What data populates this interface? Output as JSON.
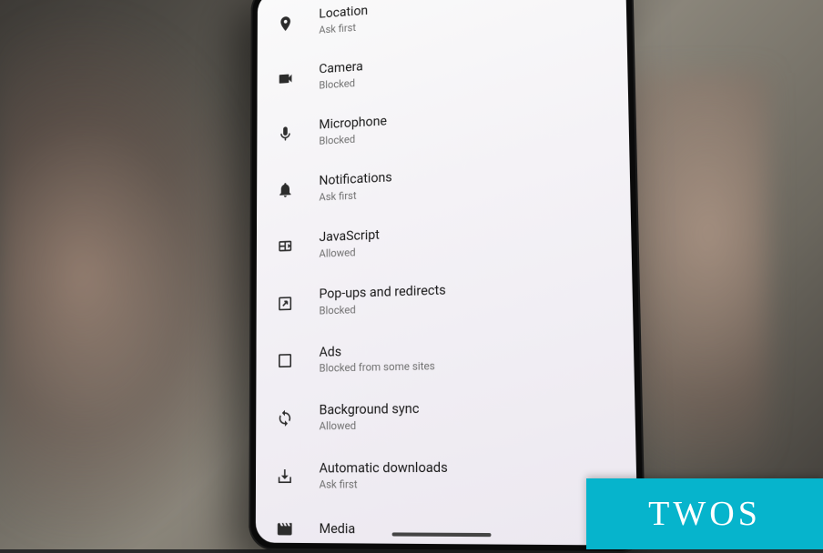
{
  "settings": {
    "items": [
      {
        "icon": "location-pin-icon",
        "title": "Location",
        "subtitle": "Ask first"
      },
      {
        "icon": "camera-icon",
        "title": "Camera",
        "subtitle": "Blocked"
      },
      {
        "icon": "microphone-icon",
        "title": "Microphone",
        "subtitle": "Blocked"
      },
      {
        "icon": "bell-icon",
        "title": "Notifications",
        "subtitle": "Ask first"
      },
      {
        "icon": "javascript-icon",
        "title": "JavaScript",
        "subtitle": "Allowed"
      },
      {
        "icon": "popup-icon",
        "title": "Pop-ups and redirects",
        "subtitle": "Blocked"
      },
      {
        "icon": "ads-icon",
        "title": "Ads",
        "subtitle": "Blocked from some sites"
      },
      {
        "icon": "sync-icon",
        "title": "Background sync",
        "subtitle": "Allowed"
      },
      {
        "icon": "download-icon",
        "title": "Automatic downloads",
        "subtitle": "Ask first"
      },
      {
        "icon": "media-icon",
        "title": "Media",
        "subtitle": ""
      }
    ]
  },
  "badge": {
    "label": "TWOS"
  }
}
